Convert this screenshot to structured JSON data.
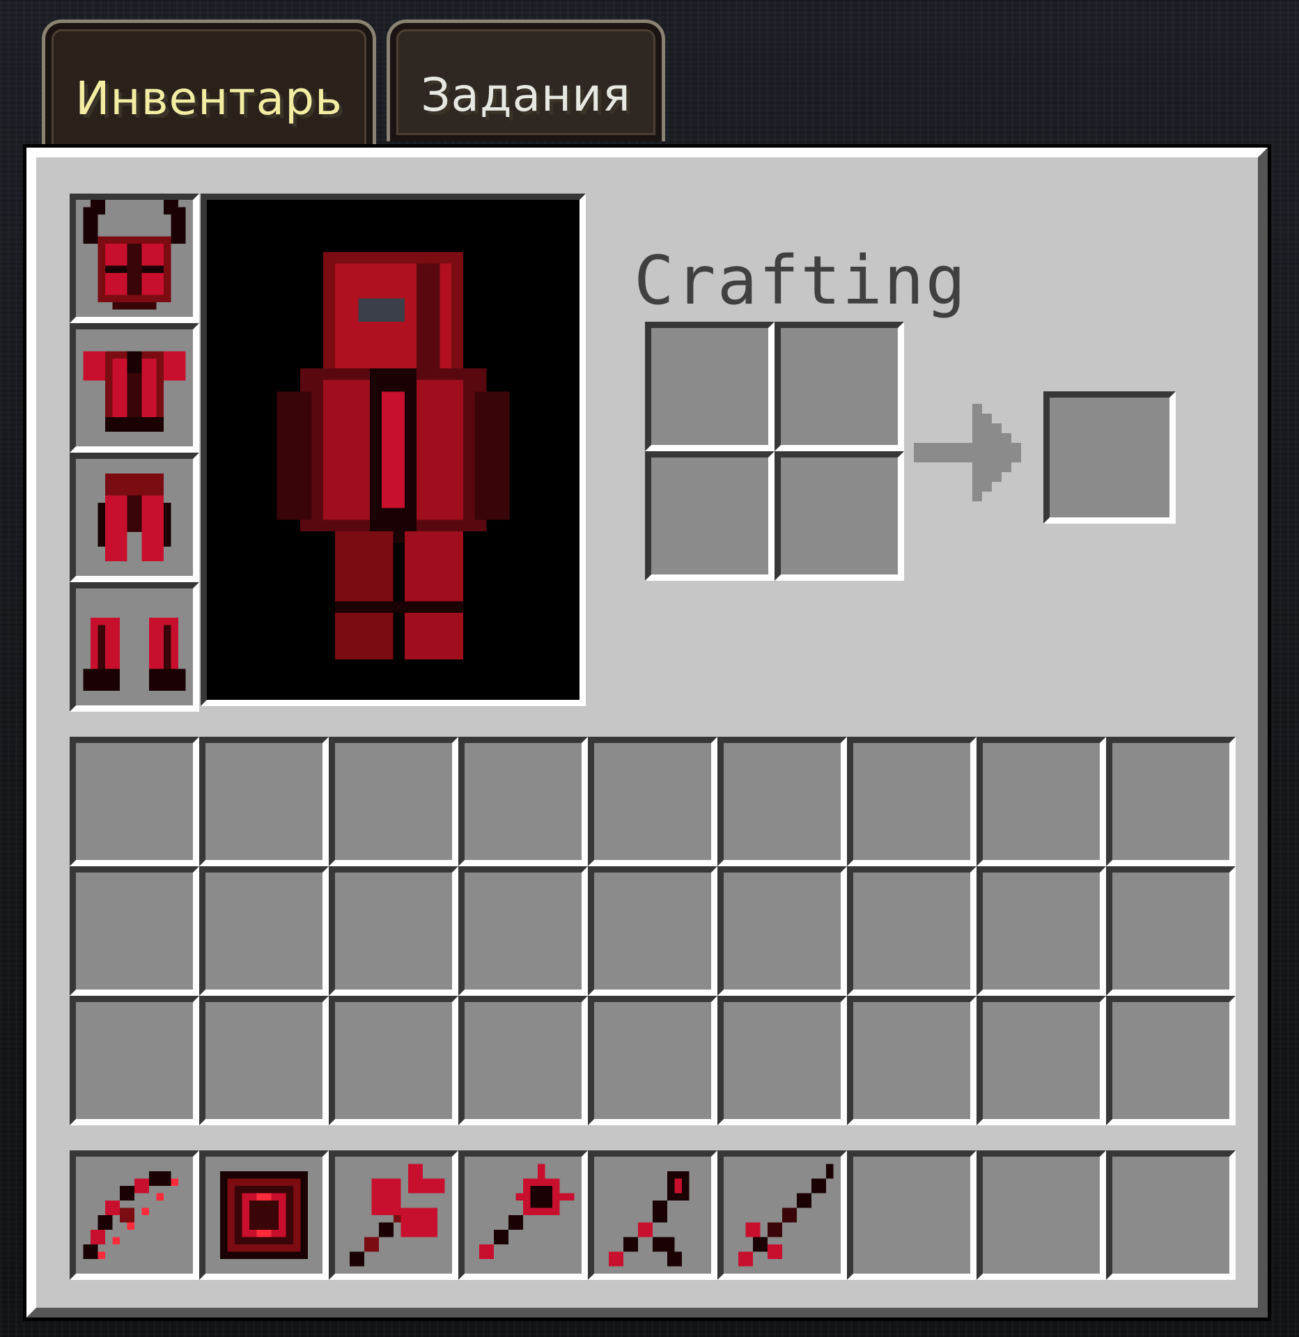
{
  "tabs": [
    {
      "label": "Инвентарь",
      "active": true
    },
    {
      "label": "Задания",
      "active": false
    }
  ],
  "crafting": {
    "title": "Crafting"
  },
  "armor_slots": [
    {
      "item": "demonic-horned-helmet-icon"
    },
    {
      "item": "demonic-chestplate-icon"
    },
    {
      "item": "demonic-leggings-icon"
    },
    {
      "item": "demonic-boots-icon"
    }
  ],
  "player_preview": {
    "skin": "red-black-demonic-armor"
  },
  "crafting_grid": [
    null,
    null,
    null,
    null
  ],
  "crafting_result": null,
  "inventory_rows": 3,
  "inventory_columns": 9,
  "hotbar": [
    {
      "item": "demonic-bow-icon"
    },
    {
      "item": "pentagram-shield-icon"
    },
    {
      "item": "double-axe-icon"
    },
    {
      "item": "spiked-mace-icon"
    },
    {
      "item": "dark-staff-icon"
    },
    {
      "item": "crimson-sword-icon"
    },
    null,
    null,
    null
  ],
  "colors": {
    "panel": "#c6c6c6",
    "slot": "#8b8b8b",
    "slot_shadow": "#373737",
    "active_tab_text": "#f2eda2",
    "tab_text": "#e8e8e2",
    "crafting_text": "#404040",
    "item_red": "#c8102e"
  }
}
